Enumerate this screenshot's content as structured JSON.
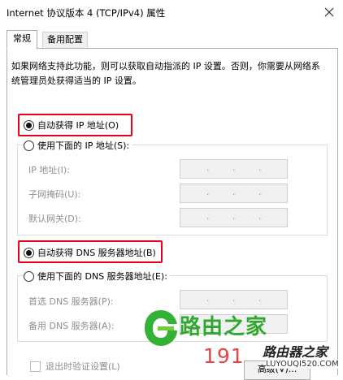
{
  "window": {
    "title": "Internet 协议版本 4 (TCP/IPv4) 属性"
  },
  "tabs": [
    {
      "label": "常规",
      "active": true
    },
    {
      "label": "备用配置",
      "active": false
    }
  ],
  "intro_text": "如果网络支持此功能，则可以获取自动指派的 IP 设置。否则，你需要从网络系统管理员处获得适当的 IP 设置。",
  "ip": {
    "auto_label": "自动获得 IP 地址(O)",
    "auto_selected": true,
    "manual_label": "使用下面的 IP 地址(S):",
    "fields": [
      {
        "label": "IP 地址(I):",
        "value": ". . ."
      },
      {
        "label": "子网掩码(U):",
        "value": ". . ."
      },
      {
        "label": "默认网关(D):",
        "value": ". . ."
      }
    ]
  },
  "dns": {
    "auto_label": "自动获得 DNS 服务器地址(B)",
    "auto_selected": true,
    "manual_label": "使用下面的 DNS 服务器地址(E):",
    "fields": [
      {
        "label": "首选 DNS 服务器(P):",
        "value": ". . ."
      },
      {
        "label": "备用 DNS 服务器(A):",
        "value": ". . ."
      }
    ]
  },
  "validate_label": "退出时验证设置(L)",
  "advanced_button": "高级(V)...",
  "watermark": {
    "name": "路由之家",
    "number": "191",
    "brand": "路由器之家",
    "url": "LUYOUQI520.COM"
  },
  "colors": {
    "highlight": "#e8001c",
    "watermark_green": "#2fa82f",
    "watermark_red": "#e64545"
  }
}
